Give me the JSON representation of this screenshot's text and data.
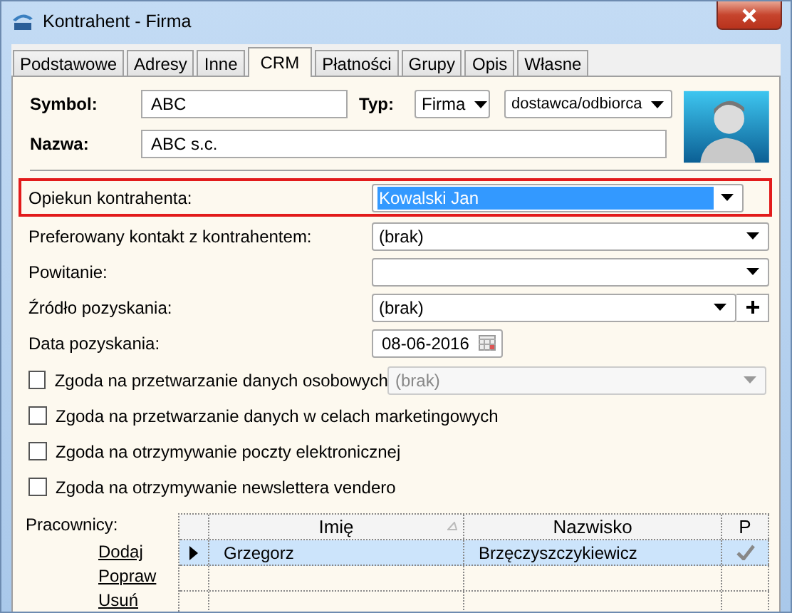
{
  "window": {
    "title": "Kontrahent - Firma"
  },
  "tabs": [
    {
      "label": "Podstawowe",
      "selected": false
    },
    {
      "label": "Adresy",
      "selected": false
    },
    {
      "label": "Inne",
      "selected": false
    },
    {
      "label": "CRM",
      "selected": true
    },
    {
      "label": "Płatności",
      "selected": false
    },
    {
      "label": "Grupy",
      "selected": false
    },
    {
      "label": "Opis",
      "selected": false
    },
    {
      "label": "Własne",
      "selected": false
    }
  ],
  "header": {
    "symbol_label": "Symbol:",
    "symbol": "ABC",
    "type_label": "Typ:",
    "type": "Firma",
    "role": "dostawca/odbiorca",
    "name_label": "Nazwa:",
    "name": "ABC s.c."
  },
  "fields": [
    {
      "kind": "combo",
      "label": "Opiekun kontrahenta:",
      "value": "Kowalski Jan",
      "highlighted": true,
      "selected": true
    },
    {
      "kind": "combo",
      "label": "Preferowany kontakt z kontrahentem:",
      "value": "(brak)"
    },
    {
      "kind": "combo",
      "label": "Powitanie:"
    },
    {
      "kind": "combo_add",
      "label": "Źródło pozyskania:",
      "value": "(brak)"
    },
    {
      "kind": "date",
      "label": "Data pozyskania:",
      "value": "08-06-2016"
    }
  ],
  "consents": [
    {
      "label": "Zgoda na przetwarzanie danych osobowych",
      "checked": false,
      "combo": {
        "value": "(brak)",
        "disabled": true
      }
    },
    {
      "label": "Zgoda na przetwarzanie danych w celach marketingowych",
      "checked": false
    },
    {
      "label": "Zgoda na otrzymywanie poczty elektronicznej",
      "checked": false
    },
    {
      "label": "Zgoda na otrzymywanie newslettera vendero",
      "checked": false
    }
  ],
  "employees": {
    "label": "Pracownicy:",
    "actions": [
      "Dodaj",
      "Popraw",
      "Usuń"
    ],
    "columns": [
      {
        "label": "Imię",
        "sorted": true
      },
      {
        "label": "Nazwisko",
        "sorted": false
      },
      {
        "label": "P",
        "sorted": false
      }
    ],
    "rows": [
      {
        "first_name": "Grzegorz",
        "last_name": "Brzęczyszczykiewicz",
        "primary": true,
        "current": true
      }
    ]
  }
}
